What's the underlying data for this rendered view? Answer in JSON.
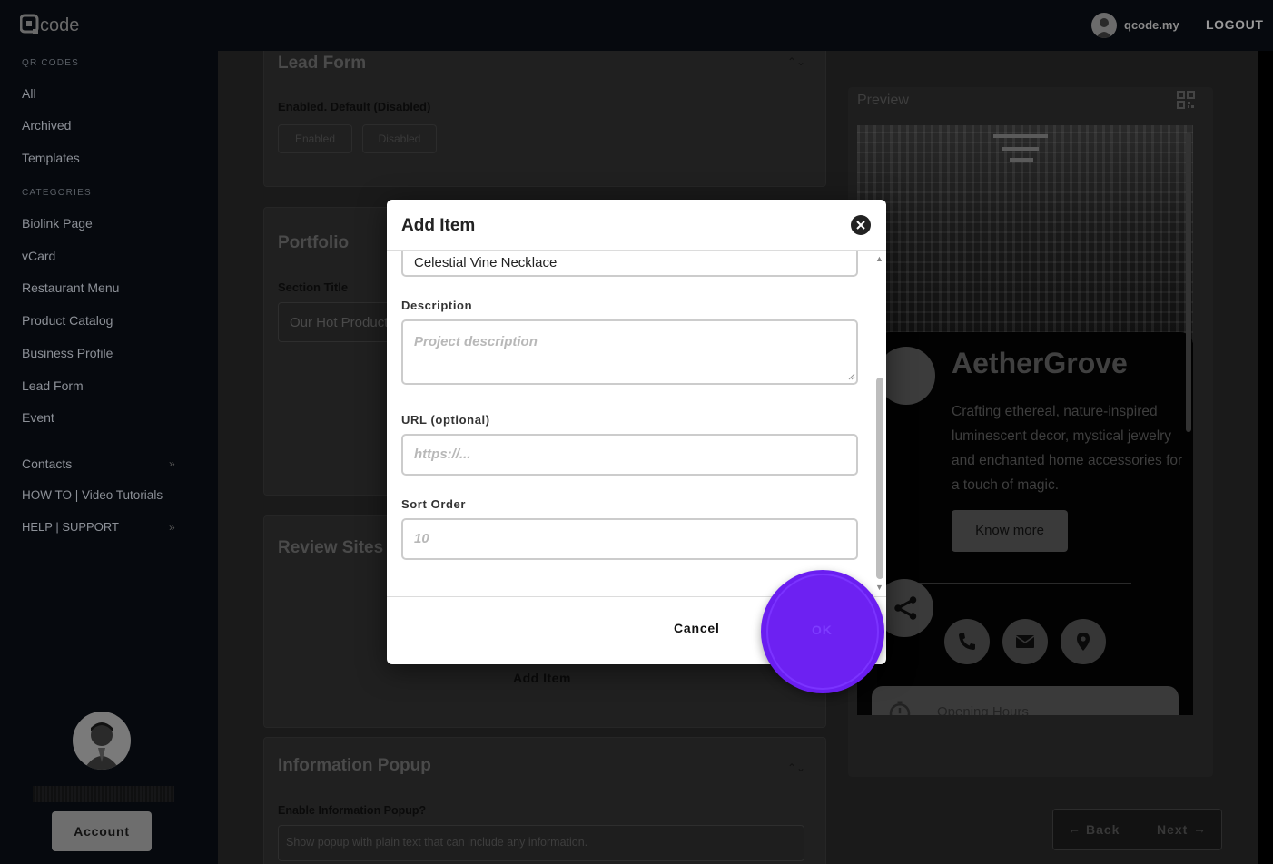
{
  "topbar": {
    "user_name": "qcode.my",
    "logout_label": "LOGOUT"
  },
  "sidebar": {
    "qr_codes_heading": "QR CODES",
    "qr_items": [
      "All",
      "Archived",
      "Templates"
    ],
    "categories_heading": "CATEGORIES",
    "category_items": [
      "Biolink Page",
      "vCard",
      "Restaurant Menu",
      "Product Catalog",
      "Business Profile",
      "Lead Form",
      "Event"
    ],
    "extra_items": [
      "Contacts",
      "HOW TO | Video Tutorials",
      "HELP | SUPPORT"
    ],
    "account_label": "Account"
  },
  "background": {
    "lead_form_title": "Lead Form",
    "lead_form_label": "Enabled. Default (Disabled)",
    "enabled_label": "Enabled",
    "disabled_label": "Disabled",
    "portfolio_title": "Portfolio",
    "section_title_label": "Section Title",
    "section_title_value": "Our Hot Products",
    "review_sites_title": "Review Sites",
    "add_item_label": "Add Item",
    "info_popup_title": "Information Popup",
    "info_popup_label": "Enable Information Popup?",
    "info_popup_hint": "Show popup with plain text that can include any information."
  },
  "preview": {
    "label": "Preview",
    "business_name": "AetherGrove",
    "description": "Crafting ethereal, nature-inspired luminescent decor, mystical jewelry and enchanted home accessories for a touch of magic.",
    "know_more": "Know more",
    "opening_hours": "Opening Hours"
  },
  "navigation": {
    "back_label": "Back",
    "next_label": "Next"
  },
  "modal": {
    "title": "Add Item",
    "name_value": "Celestial Vine Necklace",
    "description_label": "Description",
    "description_placeholder": "Project description",
    "url_label": "URL (optional)",
    "url_placeholder": "https://...",
    "sort_label": "Sort Order",
    "sort_placeholder": "10",
    "cancel_label": "Cancel",
    "ok_label": "OK"
  },
  "colors": {
    "click_indicator": "#6a1ef0",
    "modal_bg": "#ffffff",
    "overlay_dim": "#1a1a1a"
  }
}
